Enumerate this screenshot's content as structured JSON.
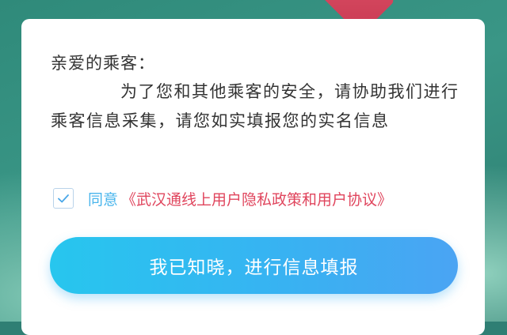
{
  "dialog": {
    "greeting": "亲爱的乘客：",
    "message": "为了您和其他乘客的安全，请协助我们进行乘客信息采集，请您如实填报您的实名信息"
  },
  "agreement": {
    "checked": true,
    "agree_label": "同意",
    "policy_link": "《武汉通线上用户隐私政策和用户协议》"
  },
  "confirm_button": {
    "label": "我已知晓，进行信息填报"
  },
  "colors": {
    "accent_blue": "#37b3f2",
    "link_red": "#e0455d",
    "background_green": "#2f8a7a"
  }
}
